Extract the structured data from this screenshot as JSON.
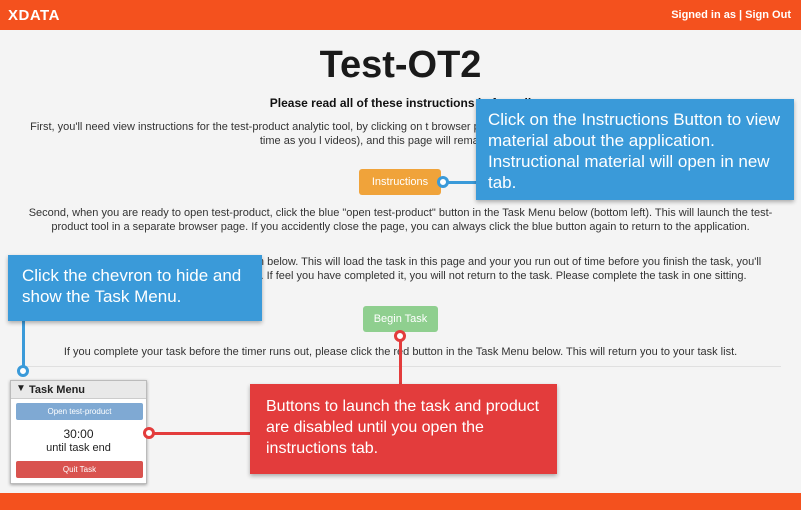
{
  "header": {
    "brand": "XDATA",
    "signin": "Signed in as | Sign Out"
  },
  "main": {
    "title": "Test-OT2",
    "subtitle": "Please read all of these instructions before cli",
    "para1": "First, you'll need view instructions for the test-product analytic tool, by clicking on t browser page where instructions are hosted. You may spend as much time as you l videos), and this page will remain active thro",
    "instructions_button": "Instructions",
    "para2": "Second, when you are ready to open test-product, click the blue \"open test-product\" button in the Task Menu below (bottom left). This will launch the test-product tool in a separate browser page. If you accidently close the page, you can always click the blue button again to return to the application.",
    "para3": "self, please click the green \"begin task\" button below. This will load the task in this page and your you run out of time before you finish the task, you'll automatically be sent back to your task list. If feel you have completed it, you will not return to the task. Please complete the task in one sitting.",
    "begin_task_button": "Begin Task",
    "para4": "If you complete your task before the timer runs out, please click the red button in the Task Menu below. This will return you to your task list."
  },
  "task_menu": {
    "title": "Task Menu",
    "open_button": "Open test-product",
    "timer": "30:00",
    "until": "until task end",
    "quit_button": "Quit Task"
  },
  "callouts": {
    "instructions": "Click on the Instructions Button to view material about the application. Instructional material will open in new tab.",
    "chevron": "Click the chevron to hide and show the Task Menu.",
    "disabled": "Buttons to launch the task and product are disabled until you open the instructions tab."
  },
  "colors": {
    "brand_orange": "#f4511e",
    "callout_blue": "#3a9ad9",
    "callout_red": "#e33c3c",
    "instructions_orange": "#f0a33a",
    "begin_green": "#8fcf8f",
    "open_blue": "#7fa9d3",
    "quit_red": "#d9534f"
  }
}
